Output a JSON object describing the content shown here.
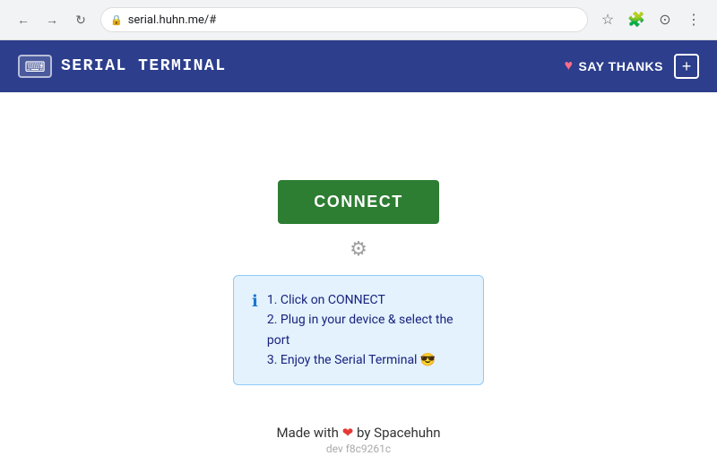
{
  "browser": {
    "url": "serial.huhn.me/#",
    "back_disabled": false,
    "forward_disabled": true
  },
  "header": {
    "title": "SERIAL TERMINAL",
    "keyboard_icon": "⌨",
    "say_thanks_label": "SAY THANKS",
    "plus_label": "+"
  },
  "main": {
    "connect_button_label": "CONNECT",
    "settings_icon": "⚙",
    "info_steps": [
      "1. Click on CONNECT",
      "2. Plug in your device & select the port",
      "3. Enjoy the Serial Terminal 😎"
    ],
    "info_icon": "ℹ"
  },
  "footer": {
    "made_with_text": "Made with",
    "heart": "❤",
    "by_text": "by Spacehuhn",
    "dev_hash": "dev f8c9261c"
  }
}
